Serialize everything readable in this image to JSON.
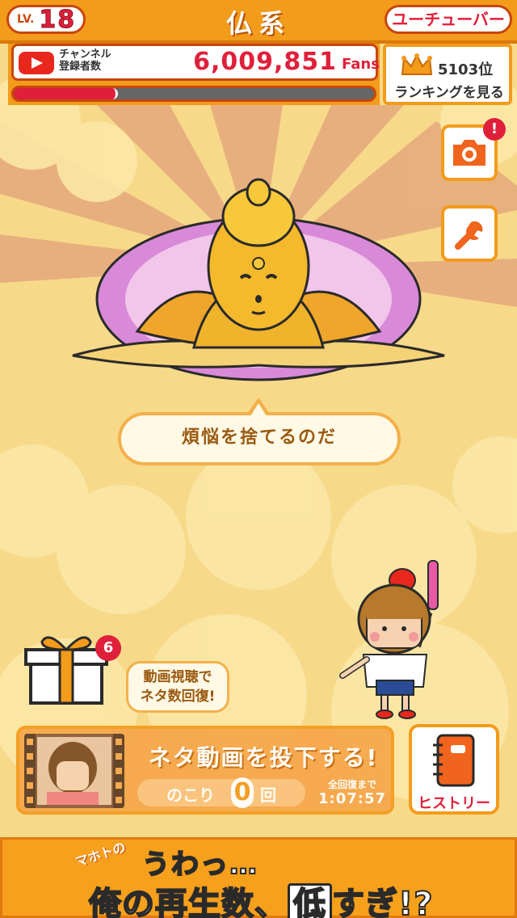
{
  "header": {
    "level_prefix": "LV.",
    "level": "18",
    "title": "仏系",
    "job": "ユーチューバー"
  },
  "channel": {
    "label_line1": "チャンネル",
    "label_line2": "登録者数",
    "subscribers": "6,009,851",
    "unit": "Fans",
    "progress": 0.29
  },
  "ranking": {
    "rank": "5103位",
    "label": "ランキングを見る"
  },
  "side_buttons": {
    "camera_notification": "!"
  },
  "buddha": {
    "message": "煩悩を捨てるのだ"
  },
  "gift": {
    "count": "6",
    "hint_line1": "動画視聴で",
    "hint_line2": "ネタ数回復!"
  },
  "upload": {
    "title": "ネタ動画を投下する!",
    "remain_prefix": "のこり",
    "remain_count": "0",
    "remain_suffix": "回",
    "recover_label": "全回復まで",
    "recover_time": "1:07:57"
  },
  "history": {
    "label": "ヒストリー"
  },
  "ad": {
    "line1_small": "マホトの",
    "line1_big": "うわっ…",
    "line2_pre": "俺の再生数、",
    "line2_red": "低",
    "line2_post": "すぎ!?"
  },
  "colors": {
    "accent_orange": "#f39b1b",
    "accent_red": "#e0203a",
    "background": "#f7d98a"
  }
}
